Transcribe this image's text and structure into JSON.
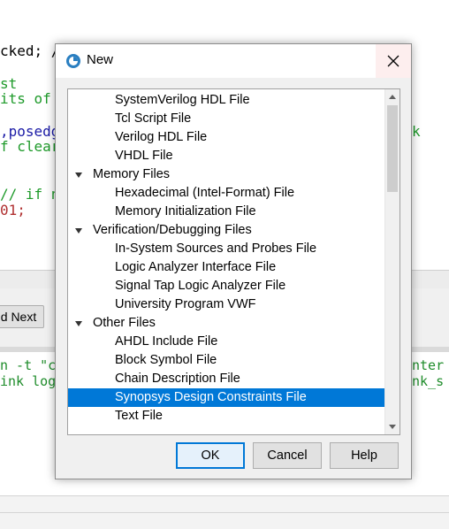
{
  "editor": {
    "lines": [
      {
        "text": "cked; /",
        "color": "#000000"
      },
      {
        "text": "st",
        "color": "#1e9a2a"
      },
      {
        "text": "its of",
        "color": "#1e9a2a"
      },
      {
        "text": ",posedg",
        "color": "#1a1aa6"
      },
      {
        "text": "f clear",
        "color": "#1e9a2a"
      },
      {
        "text": "// if n",
        "color": "#1e9a2a"
      },
      {
        "text": "01;",
        "color": "#b03030"
      }
    ],
    "right_fragment": "k",
    "find_next_label": "d Next"
  },
  "console": {
    "lines_left": [
      "n -t \"c",
      "ink log"
    ],
    "lines_right": [
      "nter",
      "nk_s"
    ]
  },
  "dialog": {
    "title": "New",
    "items": [
      {
        "type": "item",
        "label": "SystemVerilog HDL File",
        "selected": false
      },
      {
        "type": "item",
        "label": "Tcl Script File",
        "selected": false
      },
      {
        "type": "item",
        "label": "Verilog HDL File",
        "selected": false
      },
      {
        "type": "item",
        "label": "VHDL File",
        "selected": false
      },
      {
        "type": "group",
        "label": "Memory Files",
        "selected": false
      },
      {
        "type": "item",
        "label": "Hexadecimal (Intel-Format) File",
        "selected": false
      },
      {
        "type": "item",
        "label": "Memory Initialization File",
        "selected": false
      },
      {
        "type": "group",
        "label": "Verification/Debugging Files",
        "selected": false
      },
      {
        "type": "item",
        "label": "In-System Sources and Probes File",
        "selected": false
      },
      {
        "type": "item",
        "label": "Logic Analyzer Interface File",
        "selected": false
      },
      {
        "type": "item",
        "label": "Signal Tap Logic Analyzer File",
        "selected": false
      },
      {
        "type": "item",
        "label": "University Program VWF",
        "selected": false
      },
      {
        "type": "group",
        "label": "Other Files",
        "selected": false
      },
      {
        "type": "item",
        "label": "AHDL Include File",
        "selected": false
      },
      {
        "type": "item",
        "label": "Block Symbol File",
        "selected": false
      },
      {
        "type": "item",
        "label": "Chain Description File",
        "selected": false
      },
      {
        "type": "item",
        "label": "Synopsys Design Constraints File",
        "selected": true
      },
      {
        "type": "item",
        "label": "Text File",
        "selected": false
      }
    ],
    "buttons": {
      "ok": "OK",
      "cancel": "Cancel",
      "help": "Help"
    },
    "selection_color": "#0078d7"
  }
}
